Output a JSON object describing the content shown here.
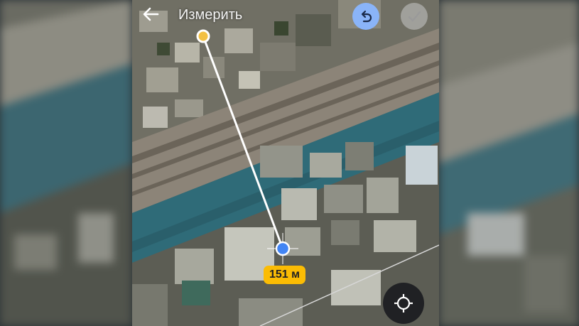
{
  "app": {
    "title": "Измерить",
    "back_icon": "arrow-back-icon",
    "undo_icon": "undo-icon",
    "done_icon": "checkmark-icon",
    "locate_icon": "my-location-icon"
  },
  "measurement": {
    "distance_label": "151 м"
  },
  "colors": {
    "undo_button": "#8ab4f8",
    "badge": "#fbbc04",
    "start_point": "#f2c043",
    "end_point": "#4285f4",
    "river": "#2f6b78"
  }
}
